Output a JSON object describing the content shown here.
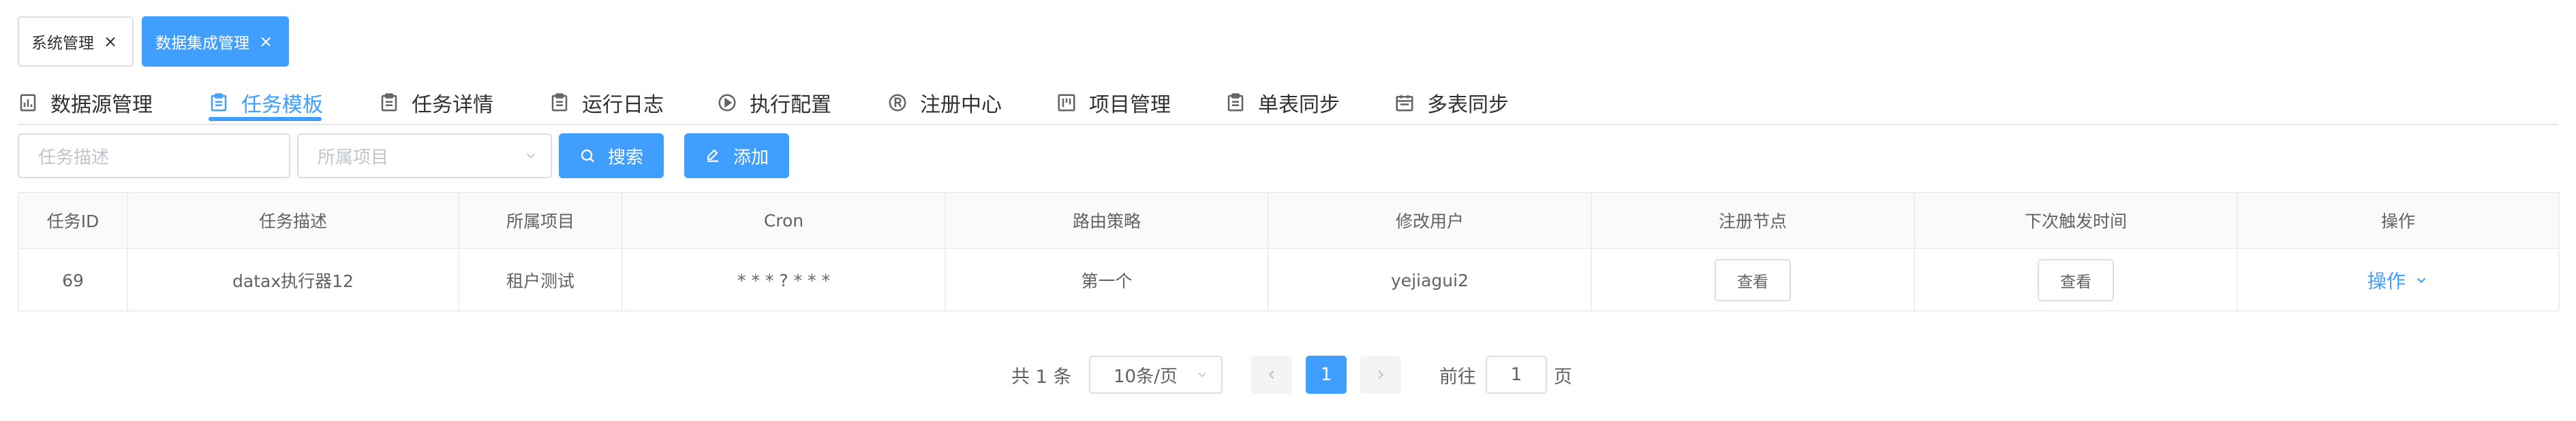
{
  "tags": [
    {
      "label": "系统管理",
      "active": false
    },
    {
      "label": "数据集成管理",
      "active": true
    }
  ],
  "nav": [
    {
      "label": "数据源管理",
      "icon": "chart-icon"
    },
    {
      "label": "任务模板",
      "icon": "clipboard-icon",
      "active": true
    },
    {
      "label": "任务详情",
      "icon": "clipboard-icon"
    },
    {
      "label": "运行日志",
      "icon": "clipboard-icon"
    },
    {
      "label": "执行配置",
      "icon": "play-circle-icon"
    },
    {
      "label": "注册中心",
      "icon": "registered-icon"
    },
    {
      "label": "项目管理",
      "icon": "board-icon"
    },
    {
      "label": "单表同步",
      "icon": "clipboard-icon"
    },
    {
      "label": "多表同步",
      "icon": "calendar-icon"
    }
  ],
  "search": {
    "task_desc_placeholder": "任务描述",
    "project_placeholder": "所属项目",
    "search_label": "搜索",
    "add_label": "添加"
  },
  "table": {
    "columns": [
      "任务ID",
      "任务描述",
      "所属项目",
      "Cron",
      "路由策略",
      "修改用户",
      "注册节点",
      "下次触发时间",
      "操作"
    ],
    "rows": [
      {
        "id": "69",
        "desc": "datax执行器12",
        "project": "租户测试",
        "cron": "* * * ? * * *",
        "route": "第一个",
        "user": "yejiagui2",
        "node_btn": "查看",
        "next_btn": "查看",
        "op": "操作"
      }
    ]
  },
  "pagination": {
    "total": "共 1 条",
    "page_size": "10条/页",
    "current": "1",
    "goto_label": "前往",
    "goto_value": "1",
    "page_unit": "页"
  },
  "colors": {
    "accent": "#409eff",
    "border": "#dcdfe6"
  }
}
